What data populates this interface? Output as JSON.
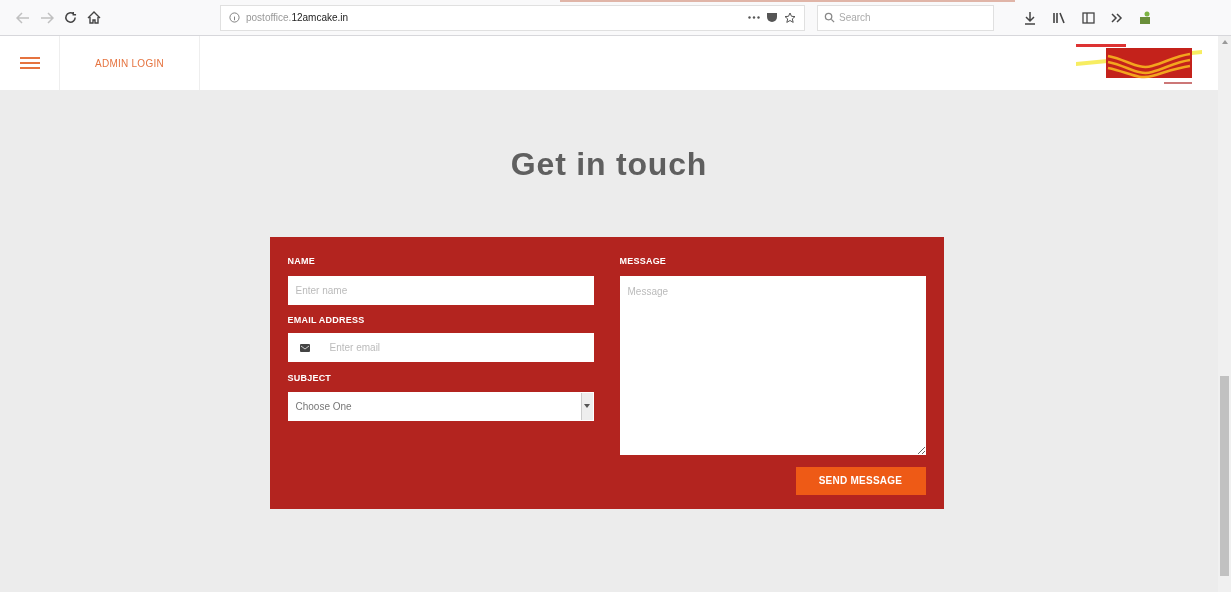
{
  "browser": {
    "url_prefix": "postoffice.",
    "url_domain": "12amcake.in",
    "search_placeholder": "Search"
  },
  "nav": {
    "menu_label": "ADMIN LOGIN"
  },
  "heading": "Get in touch",
  "form": {
    "name": {
      "label": "NAME",
      "placeholder": "Enter name"
    },
    "email": {
      "label": "EMAIL ADDRESS",
      "placeholder": "Enter email"
    },
    "subject": {
      "label": "SUBJECT",
      "value": "Choose One"
    },
    "message": {
      "label": "MESSAGE",
      "placeholder": "Message"
    },
    "submit": "SEND MESSAGE"
  }
}
